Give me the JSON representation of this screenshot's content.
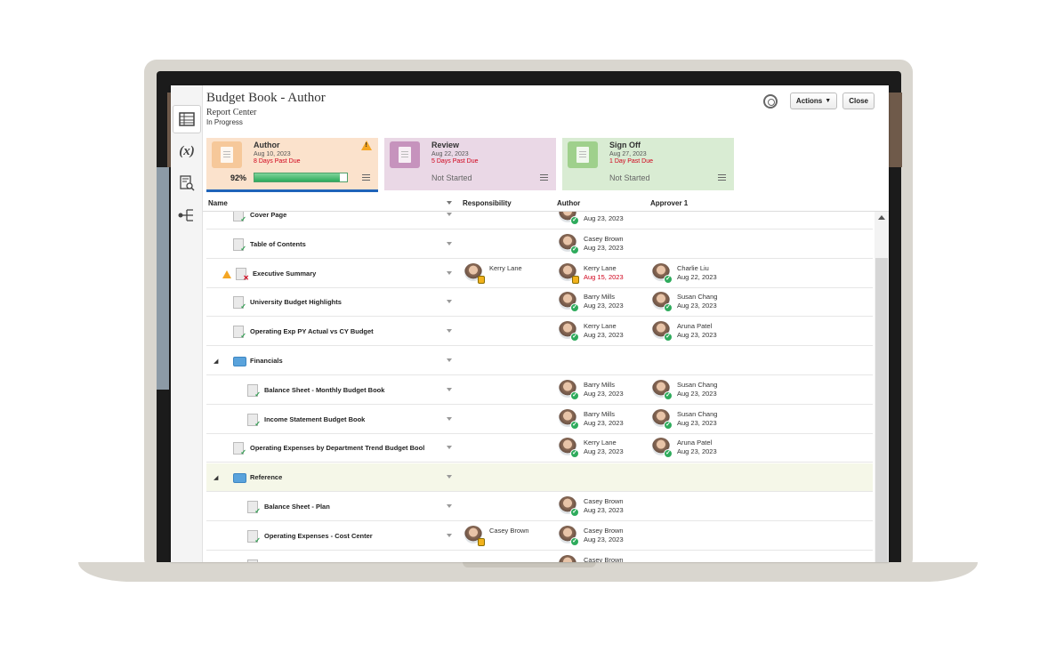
{
  "header": {
    "title": "Budget Book - Author",
    "subtitle": "Report Center",
    "status": "In Progress"
  },
  "toolbar": {
    "actions_label": "Actions",
    "close_label": "Close"
  },
  "rail": {
    "variable_label": "(x)"
  },
  "stages": [
    {
      "name": "Author",
      "date": "Aug 10, 2023",
      "due": "8 Days Past Due",
      "percent": "92%",
      "progress": 0.92,
      "color": "#fbe2cc",
      "icon_color": "#f6c89a",
      "warning": true
    },
    {
      "name": "Review",
      "date": "Aug 22, 2023",
      "due": "5 Days Past Due",
      "state": "Not Started",
      "color": "#ead8e6",
      "icon_color": "#c693bd"
    },
    {
      "name": "Sign Off",
      "date": "Aug 27, 2023",
      "due": "1 Day Past Due",
      "state": "Not Started",
      "color": "#d9ecd3",
      "icon_color": "#9fd08c"
    }
  ],
  "columns": {
    "name": "Name",
    "responsibility": "Responsibility",
    "author": "Author",
    "approver": "Approver 1"
  },
  "rows": [
    {
      "name": "Cover Page",
      "author": {
        "name": "",
        "date": "Aug 23, 2023"
      }
    },
    {
      "name": "Table of Contents",
      "author": {
        "name": "Casey Brown",
        "date": "Aug 23, 2023"
      }
    },
    {
      "name": "Executive Summary",
      "warning": true,
      "responsibility": "Kerry Lane",
      "author": {
        "name": "Kerry Lane",
        "date": "Aug 15, 2023",
        "late": true
      },
      "approver": {
        "name": "Charlie Liu",
        "date": "Aug 22, 2023"
      }
    },
    {
      "name": "University Budget Highlights",
      "author": {
        "name": "Barry Mills",
        "date": "Aug 23, 2023"
      },
      "approver": {
        "name": "Susan Chang",
        "date": "Aug 23, 2023"
      }
    },
    {
      "name": "Operating Exp PY Actual vs CY Budget",
      "author": {
        "name": "Kerry Lane",
        "date": "Aug 23, 2023"
      },
      "approver": {
        "name": "Aruna Patel",
        "date": "Aug 23, 2023"
      }
    },
    {
      "name": "Financials",
      "folder": true
    },
    {
      "name": "Balance Sheet - Monthly Budget Book",
      "indent": true,
      "author": {
        "name": "Barry Mills",
        "date": "Aug 23, 2023"
      },
      "approver": {
        "name": "Susan Chang",
        "date": "Aug 23, 2023"
      }
    },
    {
      "name": "Income Statement Budget Book",
      "indent": true,
      "author": {
        "name": "Barry Mills",
        "date": "Aug 23, 2023"
      },
      "approver": {
        "name": "Susan Chang",
        "date": "Aug 23, 2023"
      }
    },
    {
      "name": "Operating Expenses by Department Trend Budget Bool",
      "author": {
        "name": "Kerry Lane",
        "date": "Aug 23, 2023"
      },
      "approver": {
        "name": "Aruna Patel",
        "date": "Aug 23, 2023"
      }
    },
    {
      "name": "Reference",
      "folder": true,
      "highlight": true
    },
    {
      "name": "Balance Sheet - Plan",
      "indent": true,
      "author": {
        "name": "Casey Brown",
        "date": "Aug 23, 2023"
      }
    },
    {
      "name": "Operating Expenses - Cost Center",
      "indent": true,
      "responsibility": "Casey Brown",
      "author": {
        "name": "Casey Brown",
        "date": "Aug 23, 2023"
      }
    },
    {
      "name": "",
      "indent": true,
      "author": {
        "name": "Casey Brown",
        "date": ""
      }
    }
  ]
}
